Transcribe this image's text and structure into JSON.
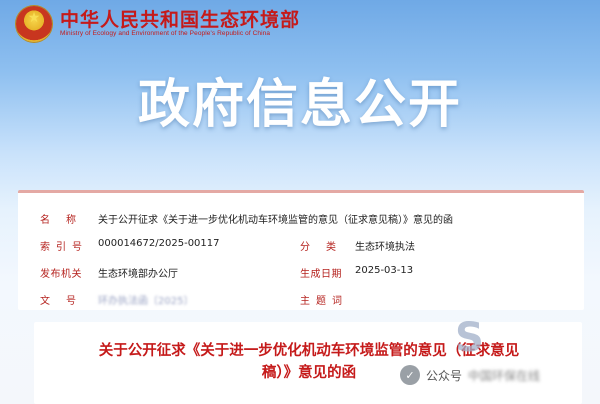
{
  "header": {
    "ministry_cn": "中华人民共和国生态环境部",
    "ministry_en": "Ministry of Ecology and Environment of the People's Republic of China"
  },
  "banner": {
    "title": "政府信息公开"
  },
  "info": {
    "name_label": "名称",
    "name_value": "关于公开征求《关于进一步优化机动车环境监管的意见（征求意见稿）》意见的函",
    "index_label": "索引号",
    "index_value": "000014672/2025-00117",
    "category_label": "分类",
    "category_value": "生态环境执法",
    "issuer_label": "发布机关",
    "issuer_value": "生态环境部办公厅",
    "date_label": "生成日期",
    "date_value": "2025-03-13",
    "docno_label": "文号",
    "docno_value": "环办执法函〔2025〕",
    "topic_label": "主题词",
    "topic_value": ""
  },
  "document": {
    "title_line1": "关于公开征求《关于进一步优化机动车环境监管的意见（征求意见",
    "title_line2": "稿）》意见的函"
  },
  "watermark": {
    "label": "公众号",
    "name": "中国环保在线"
  },
  "colors": {
    "brand_red": "#c51a1a",
    "label_red": "#b5231f",
    "banner_blue": "#6fa9e6"
  }
}
